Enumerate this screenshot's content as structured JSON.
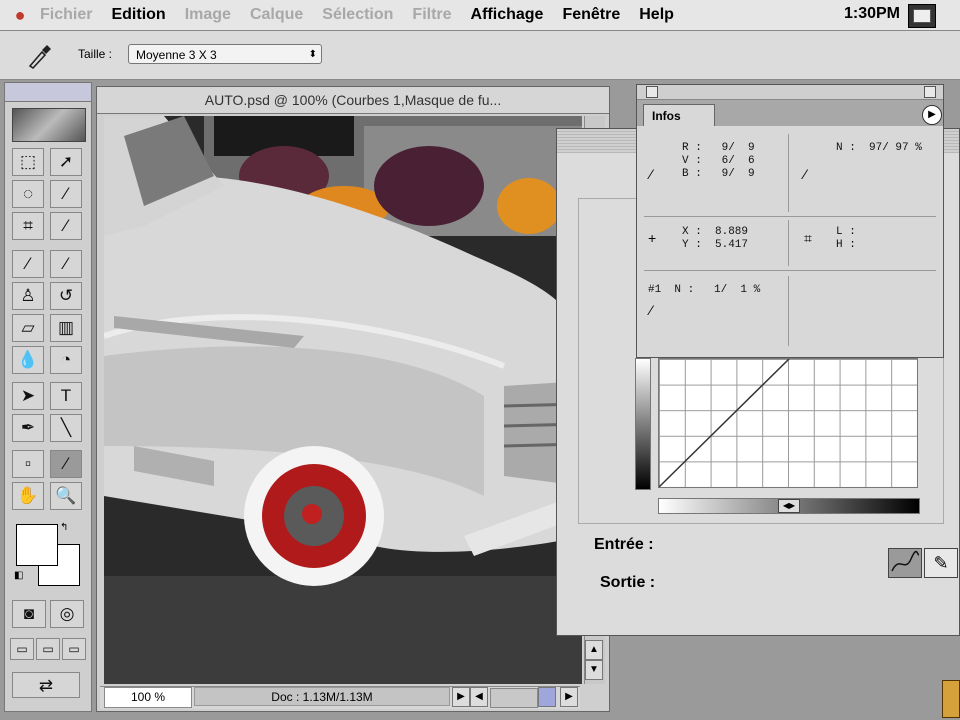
{
  "menubar": {
    "apple": "",
    "items": [
      {
        "label": "Fichier",
        "enabled": false
      },
      {
        "label": "Edition",
        "enabled": true
      },
      {
        "label": "Image",
        "enabled": false
      },
      {
        "label": "Calque",
        "enabled": false
      },
      {
        "label": "Sélection",
        "enabled": false
      },
      {
        "label": "Filtre",
        "enabled": false
      },
      {
        "label": "Affichage",
        "enabled": true
      },
      {
        "label": "Fenêtre",
        "enabled": true
      },
      {
        "label": "Help",
        "enabled": true
      }
    ],
    "clock": "1:30PM"
  },
  "options": {
    "label": "Taille :",
    "size_value": "Moyenne 3 X 3",
    "tool_icon": "eyedropper-icon"
  },
  "document": {
    "title": "AUTO.psd @ 100% (Courbes 1,Masque de fu...",
    "zoom": "100 %",
    "doc_size": "Doc : 1.13M/1.13M"
  },
  "curves": {
    "entree_label": "Entrée :",
    "sortie_label": "Sortie :"
  },
  "infos": {
    "tab_label": "Infos",
    "rgb": "R :   9/  9\nV :   6/  6\nB :   9/  9",
    "k": "N :  97/ 97 %",
    "xy": "X :  8.889\nY :  5.417",
    "lh": "L :\nH :",
    "sample": "#1  N :   1/  1 %"
  },
  "colors": {
    "menubar_bg": "#e6e6e6",
    "disabled_menu": "#a8a8a8",
    "dialog_bg": "#dcdcdc",
    "tire_red": "#b01a1a"
  }
}
